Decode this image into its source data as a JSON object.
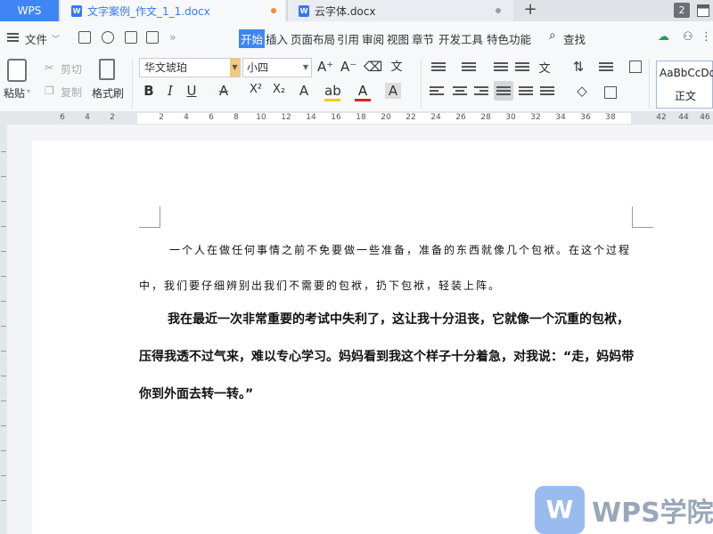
{
  "app": {
    "name": "WPS"
  },
  "tabs": [
    {
      "title": "文字案例_作文_1_1.docx",
      "active": true,
      "unsaved": true
    },
    {
      "title": "云字体.docx",
      "active": false,
      "unsaved": false
    }
  ],
  "tab_count": "2",
  "menu": {
    "file_label": "文件",
    "items": [
      "开始",
      "插入",
      "页面布局",
      "引用",
      "审阅",
      "视图",
      "章节",
      "开发工具",
      "特色功能"
    ],
    "active_item": "开始",
    "search_label": "查找"
  },
  "ribbon": {
    "paste_label": "粘贴",
    "cut_label": "剪切",
    "copy_label": "复制",
    "format_painter_label": "格式刷",
    "font_name": "华文琥珀",
    "font_size": "小四",
    "bold": "B",
    "italic": "I",
    "underline": "U",
    "strikethrough": "A",
    "superscript": "X²",
    "subscript": "X₂",
    "style_sample": "AaBbCcDd",
    "style_name": "正文"
  },
  "ruler": {
    "left_numbers": [
      "6",
      "4",
      "2"
    ],
    "numbers": [
      "2",
      "4",
      "6",
      "8",
      "10",
      "12",
      "14",
      "16",
      "18",
      "20",
      "22",
      "24",
      "26",
      "28",
      "30",
      "32",
      "34",
      "36",
      "38"
    ],
    "right_numbers": [
      "42",
      "44",
      "46"
    ]
  },
  "document": {
    "paragraph1": "一个人在做任何事情之前不免要做一些准备，准备的东西就像几个包袱。在这个过程中，我们要仔细辨别出我们不需要的包袱，扔下包袱，轻装上阵。",
    "paragraph2": "我在最近一次非常重要的考试中失利了，这让我十分沮丧，它就像一个沉重的包袱，压得我透不过气来，难以专心学习。妈妈看到我这个样子十分着急，对我说：“走，妈妈带你到外面去转一转。”"
  },
  "watermark": {
    "text": "WPS学院",
    "logo_letter": "W"
  }
}
